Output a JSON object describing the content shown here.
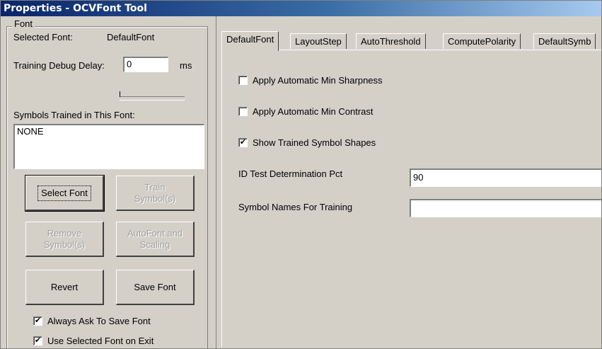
{
  "window": {
    "title": "Properties - OCVFont Tool"
  },
  "font_group": {
    "legend": "Font",
    "selected_font_label": "Selected Font:",
    "selected_font_value": "DefaultFont",
    "debug_delay_label": "Training Debug Delay:",
    "debug_delay_value": "0",
    "debug_delay_unit": "ms",
    "debug_delay_slider_level": 0,
    "symbols_trained_label": "Symbols Trained in This Font:",
    "symbols_trained_value": "NONE",
    "buttons": {
      "select_font": "Select Font",
      "train_symbols_line1": "Train",
      "train_symbols_line2": "Symbol(s)",
      "remove_symbols_line1": "Remove",
      "remove_symbols_line2": "Symbol(s)",
      "autofont_line1": "AutoFont and",
      "autofont_line2": "Scaling",
      "revert": "Revert",
      "save_font": "Save Font"
    },
    "always_ask_label": "Always Ask To Save Font",
    "always_ask_checked": true,
    "use_selected_label": "Use Selected Font on Exit",
    "use_selected_checked": true
  },
  "tabs": [
    {
      "label": "DefaultFont",
      "active": true
    },
    {
      "label": "LayoutStep",
      "active": false
    },
    {
      "label": "AutoThreshold",
      "active": false
    },
    {
      "label": "ComputePolarity",
      "active": false
    },
    {
      "label": "DefaultSymb",
      "active": false
    }
  ],
  "default_font_tab": {
    "min_sharpness_label": "Apply Automatic Min Sharpness",
    "min_sharpness_checked": false,
    "min_contrast_label": "Apply Automatic Min Contrast",
    "min_contrast_checked": false,
    "show_shapes_label": "Show Trained Symbol Shapes",
    "show_shapes_checked": true,
    "id_test_label": "ID Test Determination Pct",
    "id_test_value": "90",
    "symbol_names_label": "Symbol Names For Training",
    "symbol_names_value": ""
  },
  "check_glyph": "✔"
}
